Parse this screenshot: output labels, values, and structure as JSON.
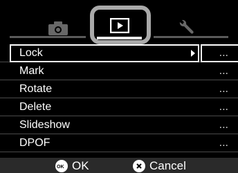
{
  "tabs": [
    {
      "name": "camera",
      "icon": "camera-icon"
    },
    {
      "name": "playback",
      "icon": "playback-icon",
      "active": true
    },
    {
      "name": "settings",
      "icon": "wrench-icon"
    }
  ],
  "menu": {
    "items": [
      {
        "label": "Lock",
        "value": "...",
        "selected": true
      },
      {
        "label": "Mark",
        "value": "..."
      },
      {
        "label": "Rotate",
        "value": "..."
      },
      {
        "label": "Delete",
        "value": "..."
      },
      {
        "label": "Slideshow",
        "value": "..."
      },
      {
        "label": "DPOF",
        "value": "..."
      }
    ]
  },
  "footer": {
    "ok_label": "OK",
    "cancel_label": "Cancel",
    "ok_icon": "ok-icon",
    "cancel_icon": "cancel-icon"
  },
  "colors": {
    "highlight_border": "#a9a9a9",
    "text": "#ffffff",
    "background": "#000000",
    "footer_bg": "#2a2a2a"
  }
}
